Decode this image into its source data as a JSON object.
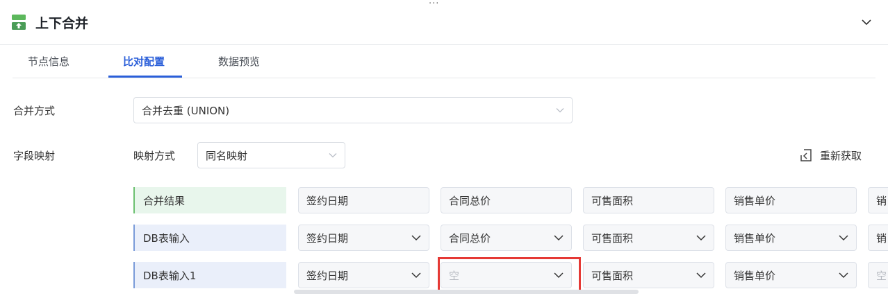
{
  "title": "上下合并",
  "tabs": [
    {
      "label": "节点信息",
      "active": false
    },
    {
      "label": "比对配置",
      "active": true
    },
    {
      "label": "数据预览",
      "active": false
    }
  ],
  "merge": {
    "label": "合并方式",
    "value": "合并去重 (UNION)"
  },
  "field_mapping": {
    "label": "字段映射",
    "mode_label": "映射方式",
    "mode_value": "同名映射",
    "refresh_label": "重新获取"
  },
  "rows": [
    {
      "label": "合并结果",
      "cells": [
        "签约日期",
        "合同总价",
        "可售面积",
        "销售单价",
        "销"
      ]
    },
    {
      "label": "DB表输入",
      "cells": [
        "签约日期",
        "合同总价",
        "可售面积",
        "销售单价",
        "销"
      ]
    },
    {
      "label": "DB表输入1",
      "cells": [
        "签约日期",
        "空",
        "可售面积",
        "销售单价",
        "空"
      ]
    }
  ],
  "colors": {
    "accent": "#2b5fd9",
    "highlight": "#e53935",
    "result_row": "#e8f6ec",
    "input_row": "#eaeffa"
  }
}
